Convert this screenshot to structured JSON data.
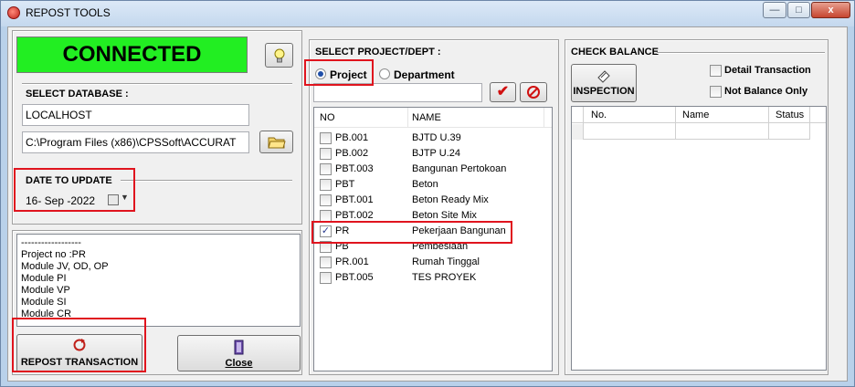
{
  "window": {
    "title": "REPOST TOOLS",
    "minimize_glyph": "—",
    "maximize_glyph": "□",
    "close_glyph": "x"
  },
  "connection": {
    "status": "CONNECTED",
    "status_color": "#22ee22"
  },
  "database": {
    "header": "SELECT DATABASE :",
    "server": "LOCALHOST",
    "path": "C:\\Program Files (x86)\\CPSSoft\\ACCURAT"
  },
  "date": {
    "header": "DATE  TO UPDATE",
    "value": "16- Sep -2022"
  },
  "log": {
    "lines": [
      "------------------",
      "Project no :PR",
      "Module JV, OD, OP",
      "Module PI",
      "Module VP",
      "Module SI",
      "Module CR"
    ]
  },
  "buttons": {
    "repost": "REPOST TRANSACTION",
    "close": "Close",
    "inspection": "INSPECTION"
  },
  "project_dept": {
    "header": "SELECT PROJECT/DEPT :",
    "radio_project": "Project",
    "radio_department": "Department",
    "selected": "Project",
    "filter_value": "",
    "columns": [
      "NO",
      "NAME"
    ],
    "rows": [
      {
        "no": "PB.001",
        "name": "BJTD U.39",
        "checked": false
      },
      {
        "no": "PB.002",
        "name": "BJTP U.24",
        "checked": false
      },
      {
        "no": "PBT.003",
        "name": "Bangunan Pertokoan",
        "checked": false
      },
      {
        "no": "PBT",
        "name": "Beton",
        "checked": false
      },
      {
        "no": "PBT.001",
        "name": "Beton Ready Mix",
        "checked": false
      },
      {
        "no": "PBT.002",
        "name": "Beton Site Mix",
        "checked": false
      },
      {
        "no": "PR",
        "name": "Pekerjaan Bangunan",
        "checked": true
      },
      {
        "no": "PB",
        "name": "Pembesiaan",
        "checked": false
      },
      {
        "no": "PR.001",
        "name": "Rumah Tinggal",
        "checked": false
      },
      {
        "no": "PBT.005",
        "name": "TES PROYEK",
        "checked": false
      }
    ]
  },
  "check_balance": {
    "header": "CHECK BALANCE",
    "detail_transaction": "Detail Transaction",
    "not_balance_only": "Not Balance Only",
    "columns": [
      "No.",
      "Name",
      "Status"
    ]
  },
  "colors": {
    "highlight_border": "#e0141e",
    "window_frame": "#b9d1ea"
  }
}
